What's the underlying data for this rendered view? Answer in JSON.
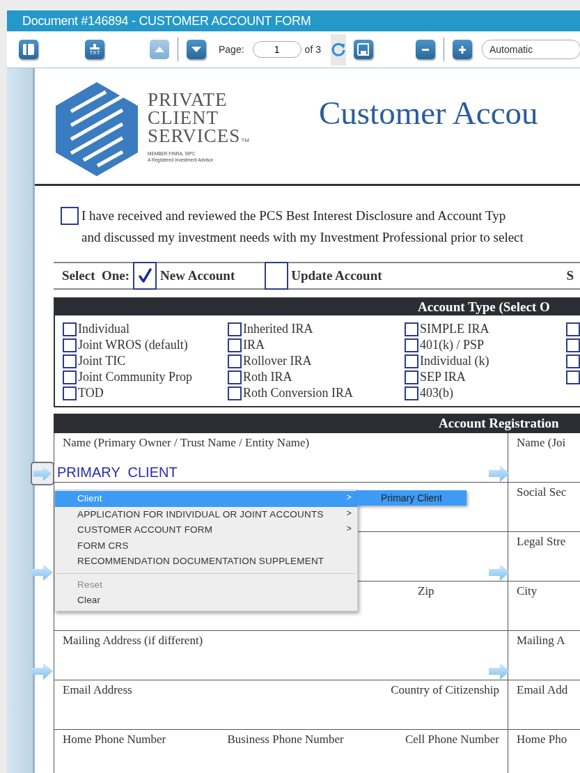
{
  "window": {
    "title": "Document #146894 - CUSTOMER ACCOUNT FORM"
  },
  "toolbar": {
    "buttons": [
      {
        "kind": "sidebar",
        "disabled": false
      },
      {
        "kind": "txt",
        "label": "TXT",
        "disabled": false
      },
      {
        "kind": "up",
        "disabled": true
      },
      {
        "kind": "down",
        "disabled": false
      }
    ],
    "page_label": "Page:",
    "page_field": {
      "value": "1"
    },
    "page_count": "of 3",
    "tools": [
      {
        "kind": "refresh",
        "disabled": false
      },
      {
        "kind": "save",
        "disabled": false
      },
      {
        "kind": "zoom-out",
        "disabled": false
      },
      {
        "kind": "zoom-in",
        "disabled": false
      }
    ],
    "zoom_select": {
      "value": "Automatic"
    }
  },
  "document": {
    "logo": {
      "lines": [
        "PRIVATE",
        "CLIENT",
        "SERVICES"
      ],
      "trademark": "TM",
      "tagline": [
        "MEMBER FINRA, SIPC",
        "A Registered Investment Advisor"
      ]
    },
    "heading": "Customer Accou",
    "disclosure": {
      "checked": false,
      "lines": [
        "I have received and reviewed the PCS Best Interest Disclosure and Account Typ",
        "and discussed my investment needs with my Investment Professional prior to select"
      ]
    },
    "select_one": {
      "label": "Select  One:",
      "options": [
        {
          "label": "New Account",
          "checked": true
        },
        {
          "label": "Update Account",
          "checked": false
        },
        {
          "label": "S"
        }
      ]
    },
    "account_type": {
      "title": "Account Type (Select O",
      "columns": [
        [
          {
            "label": "Individual",
            "checked": false
          },
          {
            "label": "Joint WROS (default)",
            "checked": false
          },
          {
            "label": "Joint TIC",
            "checked": false
          },
          {
            "label": "Joint Community Prop",
            "checked": false
          },
          {
            "label": "TOD",
            "checked": false
          }
        ],
        [
          {
            "label": "Inherited IRA",
            "checked": false
          },
          {
            "label": "IRA",
            "checked": false
          },
          {
            "label": "Rollover IRA",
            "checked": false
          },
          {
            "label": "Roth IRA",
            "checked": false
          },
          {
            "label": "Roth Conversion IRA",
            "checked": false
          }
        ],
        [
          {
            "label": "SIMPLE IRA",
            "checked": false
          },
          {
            "label": "401(k) / PSP",
            "checked": false
          },
          {
            "label": "Individual (k)",
            "checked": false
          },
          {
            "label": "SEP IRA",
            "checked": false
          },
          {
            "label": "403(b)",
            "checked": false
          }
        ],
        [
          {
            "checked": false
          },
          {
            "checked": false
          },
          {
            "checked": false
          },
          {
            "checked": false
          }
        ]
      ]
    },
    "registration": {
      "title": "Account Registration",
      "rows": [
        {
          "kind": "single",
          "labels": [
            "Name (Primary Owner / Trust Name / Entity Name)"
          ],
          "value": "PRIMARY  CLIENT",
          "right": "Name (Joi",
          "arrows": true,
          "arrow_focused": true
        },
        {
          "right": "Social Sec"
        },
        {
          "right": "Legal Stre",
          "arrows": true,
          "arrow_focused": false
        },
        {
          "kind": "zip",
          "labels": [
            "Zip"
          ],
          "right": "City"
        },
        {
          "kind": "single",
          "labels": [
            "Mailing Address (if different)"
          ],
          "right": "Mailing A",
          "arrows": true,
          "arrow_focused": false
        },
        {
          "kind": "spread",
          "labels": [
            "Email Address",
            "Country of Citizenship"
          ],
          "right": "Email Add"
        },
        {
          "kind": "spread",
          "labels": [
            "Home Phone Number",
            "Business Phone Number",
            "Cell Phone Number"
          ],
          "right": "Home Pho"
        }
      ]
    }
  },
  "context_menu": {
    "items": [
      {
        "kind": "item",
        "label": "Client",
        "selected": true,
        "disabled": false,
        "submenu_mark": ">",
        "children": [
          {
            "label": "Primary Client",
            "selected": true
          }
        ]
      },
      {
        "kind": "item",
        "label": "APPLICATION FOR INDIVIDUAL OR JOINT ACCOUNTS",
        "selected": false,
        "disabled": false,
        "submenu_mark": ">"
      },
      {
        "kind": "item",
        "label": "CUSTOMER ACCOUNT FORM",
        "selected": false,
        "disabled": false,
        "submenu_mark": ">"
      },
      {
        "kind": "item",
        "label": "FORM CRS",
        "selected": false,
        "disabled": false
      },
      {
        "kind": "item",
        "label": "RECOMMENDATION DOCUMENTATION SUPPLEMENT",
        "selected": false,
        "disabled": false
      },
      {
        "kind": "separator"
      },
      {
        "kind": "item",
        "label": "Reset",
        "selected": false,
        "disabled": true
      },
      {
        "kind": "item",
        "label": "Clear",
        "selected": false,
        "disabled": false
      }
    ]
  }
}
